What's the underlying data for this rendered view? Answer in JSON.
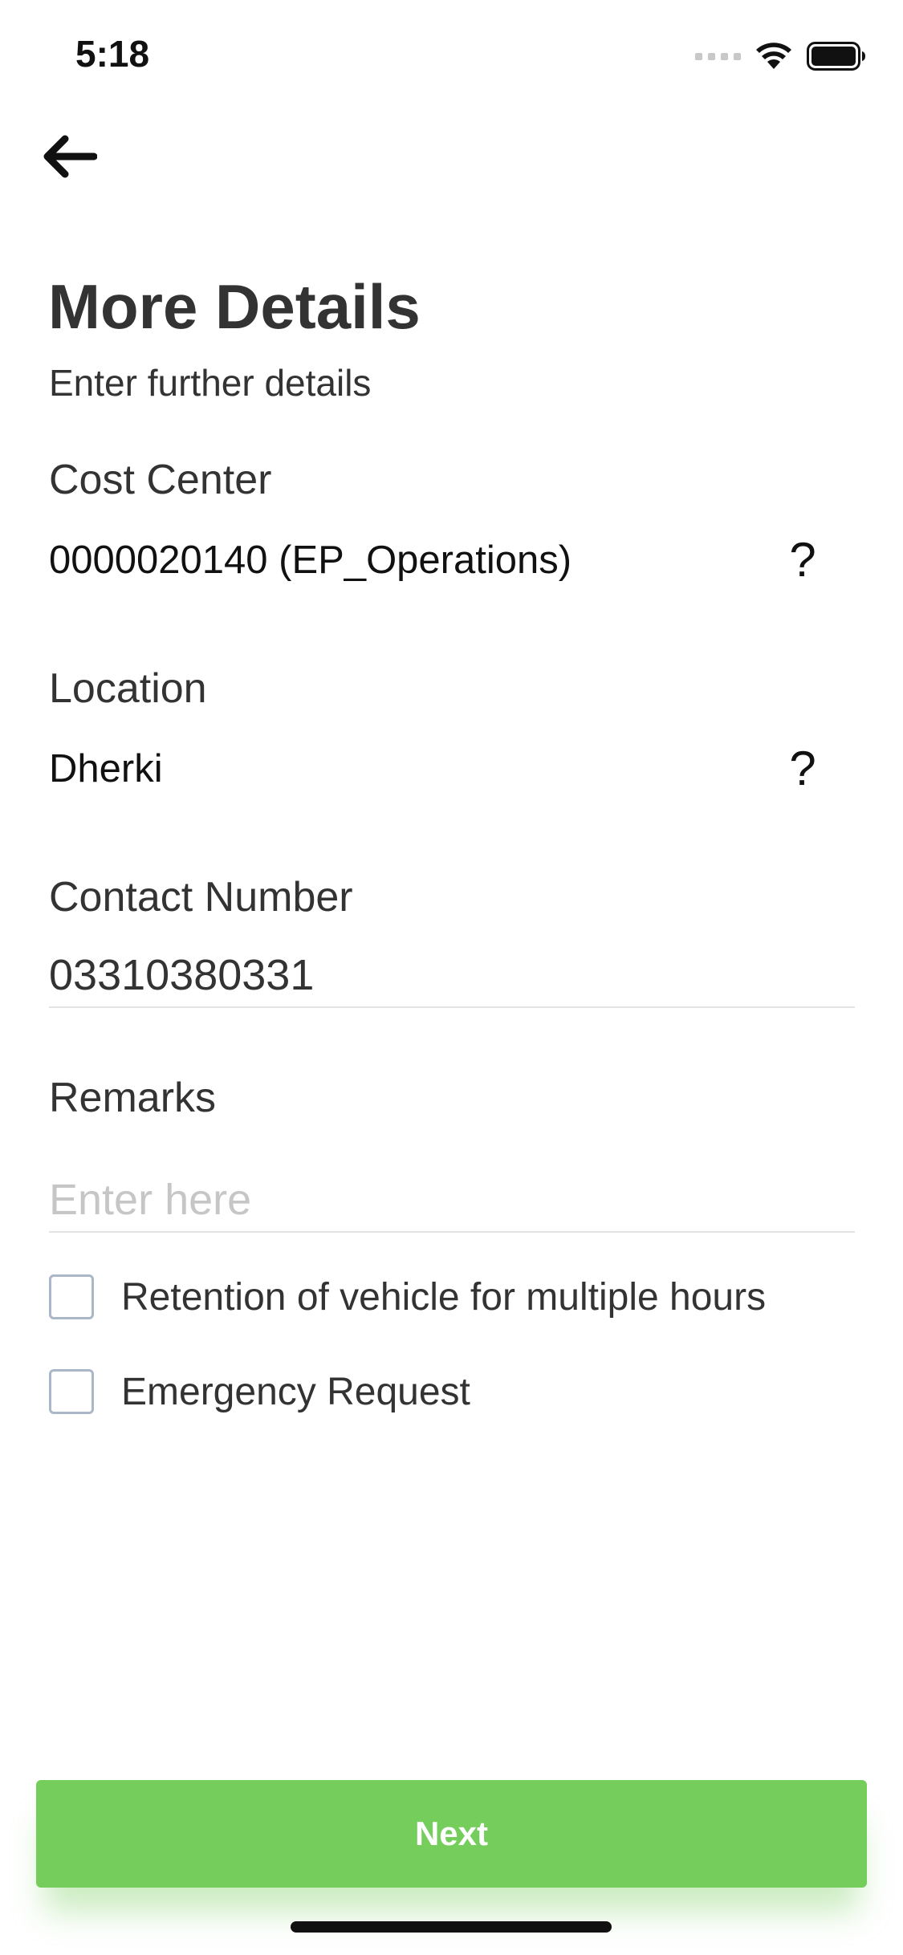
{
  "status_bar": {
    "time": "5:18",
    "wifi_icon": "wifi-icon",
    "battery_icon": "battery-icon"
  },
  "header": {
    "back_icon": "arrow-left-icon",
    "title": "More Details",
    "subtitle": "Enter further details"
  },
  "cost_center": {
    "label": "Cost Center",
    "value": "0000020140 (EP_Operations)",
    "help": "?"
  },
  "location": {
    "label": "Location",
    "value": "Dherki",
    "help": "?"
  },
  "contact_number": {
    "label": "Contact Number",
    "value": "03310380331"
  },
  "remarks": {
    "label": "Remarks",
    "placeholder": "Enter here",
    "value": ""
  },
  "options": [
    {
      "label": "Retention of vehicle for multiple hours",
      "checked": false
    },
    {
      "label": "Emergency Request",
      "checked": false
    }
  ],
  "footer": {
    "next_label": "Next"
  },
  "colors": {
    "accent": "#75ce5b",
    "text": "#333333",
    "placeholder": "#c6c6c6",
    "checkbox_border": "#a9b7c8"
  }
}
